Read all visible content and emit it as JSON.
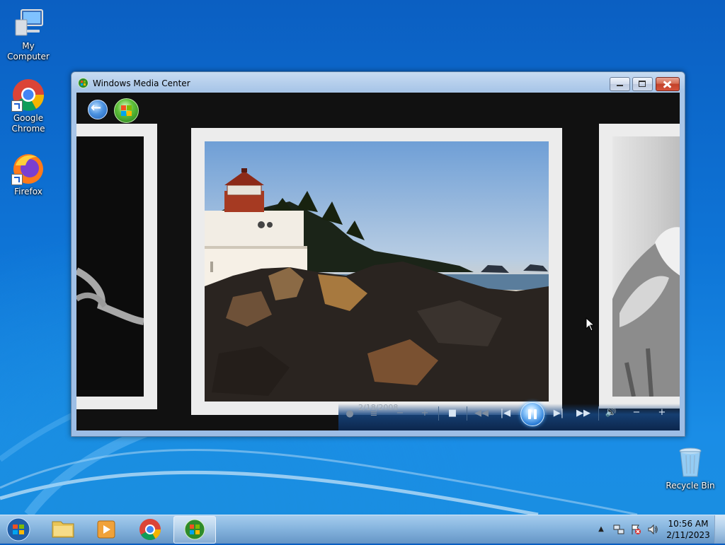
{
  "desktop": {
    "icons": [
      {
        "label": "My Computer"
      },
      {
        "label": "Google Chrome"
      },
      {
        "label": "Firefox"
      },
      {
        "label": "Recycle Bin"
      }
    ]
  },
  "window": {
    "title": "Windows Media Center"
  },
  "slideshow": {
    "date": "2/18/2008",
    "state": "playing"
  },
  "taskbar": {
    "clock_time": "10:56 AM",
    "clock_date": "2/11/2023"
  },
  "colors": {
    "desktop": "#0e74d6",
    "window_frame": "#a9c6e8",
    "transport_glow": "#2d7fd8"
  }
}
